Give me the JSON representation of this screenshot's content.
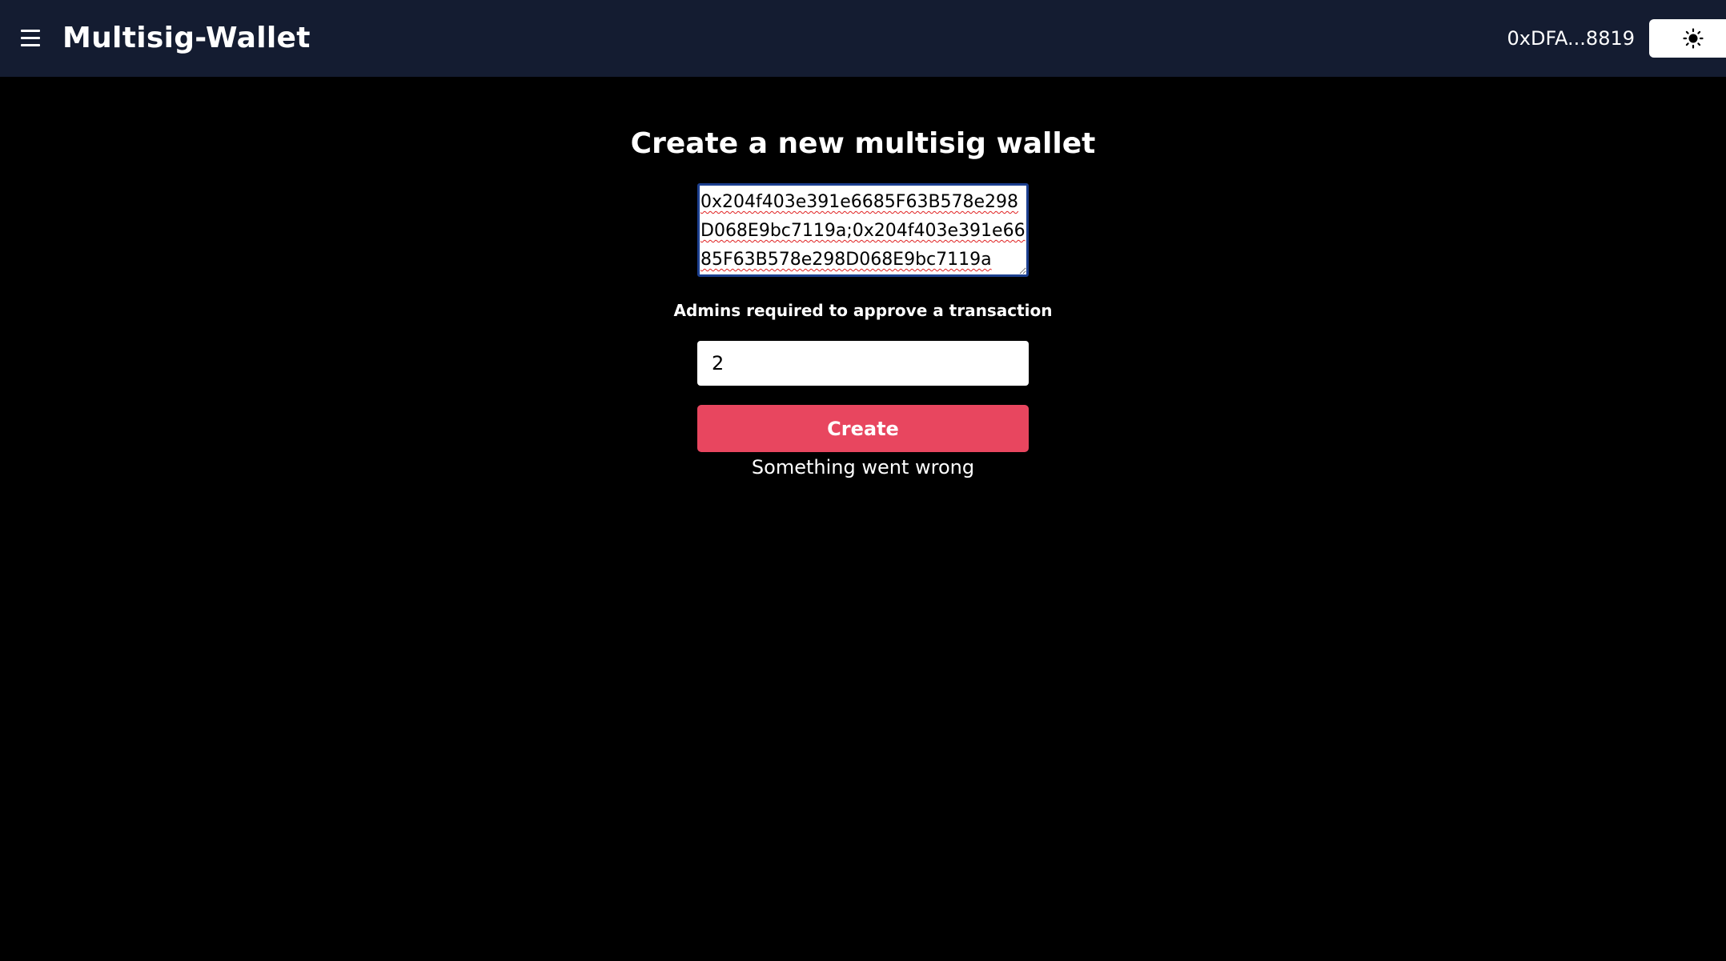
{
  "header": {
    "menu_icon": "hamburger-menu-icon",
    "app_title": "Multisig-Wallet",
    "account_address": "0xDFA...8819",
    "theme_icon": "sun-icon"
  },
  "form": {
    "heading": "Create a new multisig wallet",
    "admins_value": "0x204f403e391e6685F63B578e298D068E9bc7119a;0x204f403e391e6685F63B578e298D068E9bc7119a",
    "quorum_label": "Admins required to approve a transaction",
    "quorum_value": "2",
    "create_label": "Create",
    "error_message": "Something went wrong"
  },
  "colors": {
    "navbar_bg": "#141c31",
    "page_bg": "#000000",
    "create_button": "#e8465f",
    "textarea_focus_border": "#1c3f8f"
  }
}
